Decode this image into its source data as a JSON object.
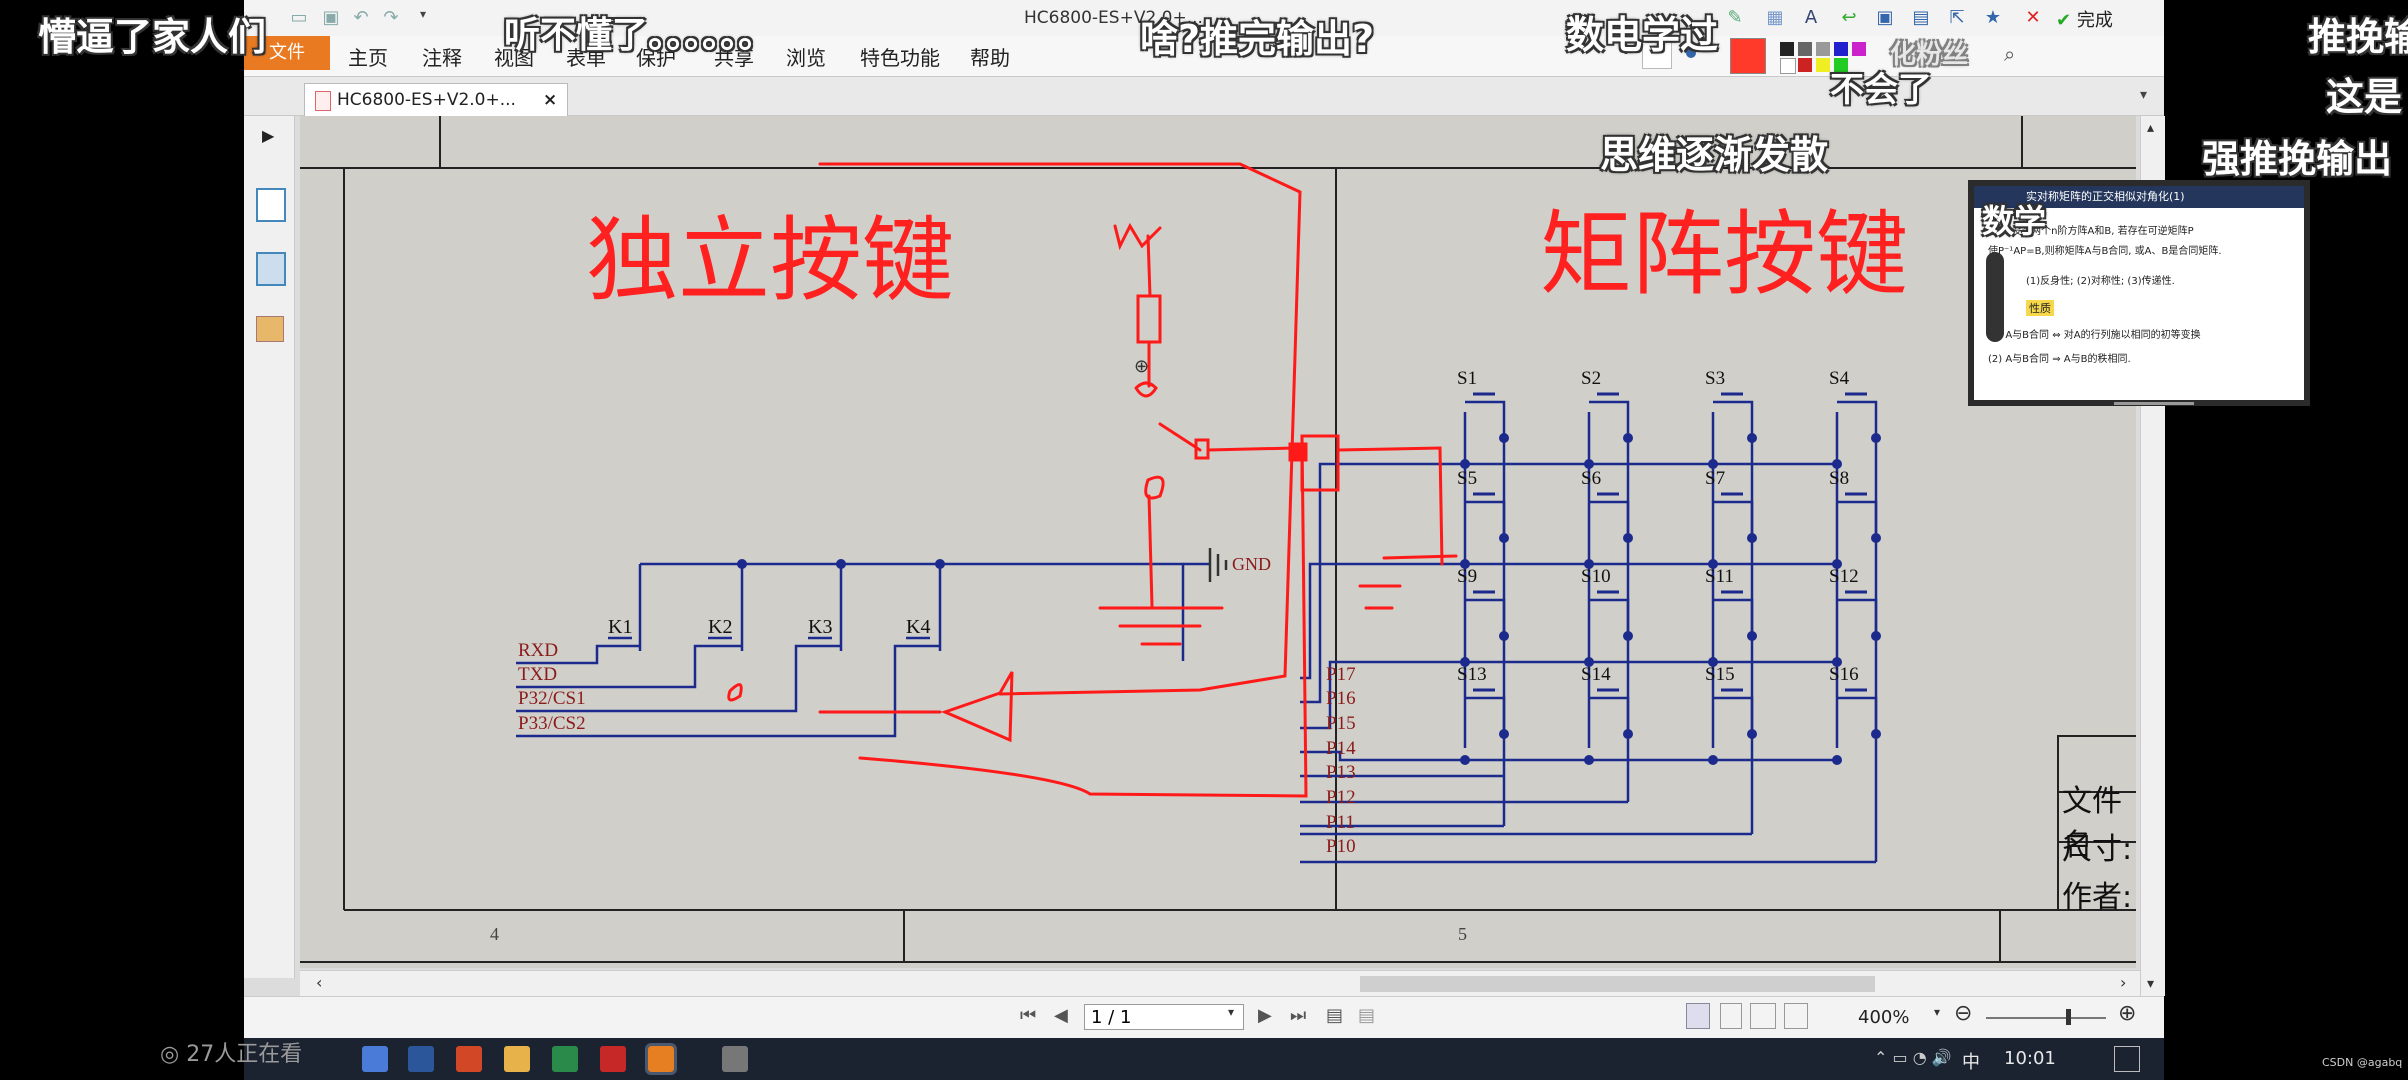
{
  "window": {
    "title": "HC6800-ES+V2.0+..."
  },
  "ribbon": {
    "file_tab": "文件",
    "tabs": [
      "主页",
      "注释",
      "视图",
      "表单",
      "保护",
      "共享",
      "浏览",
      "特色功能",
      "帮助"
    ],
    "finish_label": "完成"
  },
  "document_tab": {
    "label": "HC6800-ES+V2.0+...",
    "close": "×"
  },
  "schematic": {
    "heading_left": "独立按键",
    "heading_right": "矩阵按键",
    "gnd_label": "GND",
    "independent_keys": [
      "K1",
      "K2",
      "K3",
      "K4"
    ],
    "independent_nets": [
      "RXD",
      "TXD",
      "P32/CS1",
      "P33/CS2"
    ],
    "matrix_keys": [
      "S1",
      "S2",
      "S3",
      "S4",
      "S5",
      "S6",
      "S7",
      "S8",
      "S9",
      "S10",
      "S11",
      "S12",
      "S13",
      "S14",
      "S15",
      "S16"
    ],
    "port_pins": [
      "P17",
      "P16",
      "P15",
      "P14",
      "P13",
      "P12",
      "P11",
      "P10"
    ],
    "zone_numbers": [
      "4",
      "5"
    ],
    "title_block": [
      "文件名",
      "尺寸:",
      "作者:"
    ]
  },
  "statusbar": {
    "page_value": "1 / 1",
    "zoom": "400%"
  },
  "taskbar": {
    "time": "10:01",
    "ime": "中"
  },
  "danmaku": {
    "d1": "懵逼了家人们",
    "d2": "听不懂了。。。。。。",
    "d3": "啥?推完输出?",
    "d4": "数电学过",
    "d5": "不会了",
    "d6": "思维逐渐发散",
    "d7": "推挽输",
    "d8": "这是",
    "d9": "强推挽输出",
    "d10": "数学",
    "d11": "化粉丝"
  },
  "pip": {
    "title": "实对称矩阵的正交相似对角化(1)",
    "line1": "定义 设实两个n阶方阵A和B, 若存在可逆矩阵P",
    "line2": "使P⁻¹AP=B,则称矩阵A与B合同, 或A、B是合同矩阵.",
    "line3": "(1)反身性; (2)对称性; (3)传递性.",
    "section": "性质",
    "line4": "(1) A与B合同 ⇔ 对A的行列施以相同的初等变换",
    "line5": "(2) A与B合同 ⇒ A与B的秩相同."
  },
  "viewers": "27人正在看",
  "watermark": "CSDN @agabq",
  "colors": {
    "file_tab": "#ea7a21",
    "wire": "#1b2a8c",
    "pen": "#ff1a1a",
    "label_red": "#8b1a1a"
  }
}
